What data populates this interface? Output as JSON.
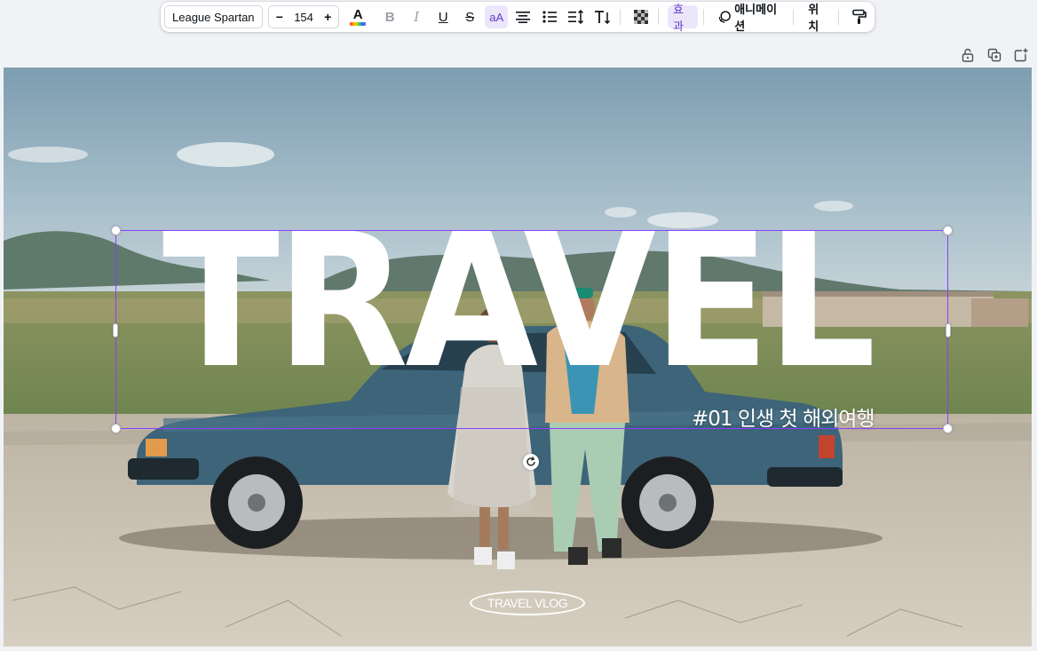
{
  "toolbar": {
    "font_name": "League Spartan",
    "font_size": "154",
    "decrease_label": "−",
    "increase_label": "+",
    "effects_label": "효과",
    "animation_label": "애니메이션",
    "position_label": "위치",
    "case_label": "aA",
    "text_color_letter": "A",
    "bold_glyph": "B",
    "italic_glyph": "I",
    "underline_glyph": "U",
    "strike_glyph": "S",
    "text_color_hex": "#0e1318",
    "active_color_hex": "#5f3bc9"
  },
  "canvas": {
    "title": "TRAVEL",
    "subtitle": "#01 인생 첫 해외여행",
    "badge": "TRAVEL VLOG"
  },
  "selection": {
    "border_color": "#8b3dff"
  },
  "icons": {
    "lock": "lock-icon",
    "duplicate": "duplicate-page-icon",
    "add_page": "add-page-icon",
    "rotate": "rotate-icon",
    "transparency": "transparency-icon",
    "animation": "animation-icon",
    "paint_format": "paint-roller-icon"
  }
}
